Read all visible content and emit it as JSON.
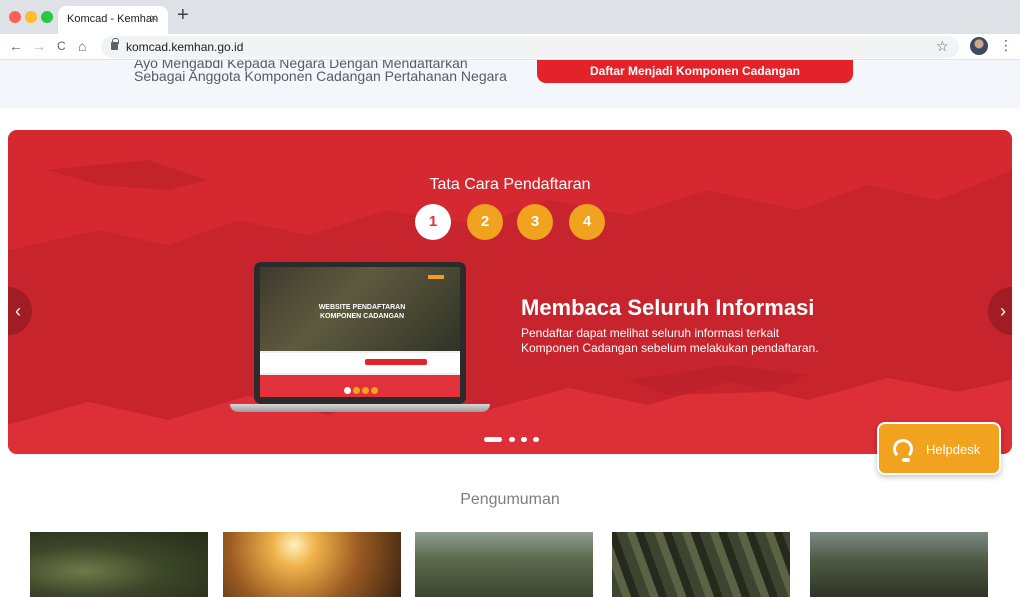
{
  "browser": {
    "tab_title": "Komcad - Kemhan",
    "tab_close": "×",
    "new_tab": "+",
    "url": "komcad.kemhan.go.id",
    "nav": {
      "back": "←",
      "forward": "→",
      "reload": "C",
      "home": "⌂"
    },
    "star": "☆",
    "menu": "⋮"
  },
  "cta": {
    "text_line1": "Ayo Mengabdi Kepada Negara Dengan Mendaftarkan",
    "text_line2": "Sebagai Anggota Komponen Cadangan Pertahanan Negara",
    "button": "Daftar Menjadi Komponen Cadangan"
  },
  "carousel": {
    "title": "Tata Cara Pendaftaran",
    "steps": [
      "1",
      "2",
      "3",
      "4"
    ],
    "active_step": 1,
    "slide_heading": "Membaca Seluruh Informasi",
    "slide_desc": "Pendaftar dapat melihat seluruh informasi terkait Komponen Cadangan sebelum melakukan pendaftaran.",
    "laptop_screen_text": "WEBSITE PENDAFTARAN KOMPONEN CADANGAN",
    "prev": "‹",
    "next": "›",
    "indicator_count": 4,
    "active_indicator": 1
  },
  "helpdesk": {
    "label": "Helpdesk",
    "icon": "headset-icon"
  },
  "announcements": {
    "title": "Pengumuman",
    "thumbnails": [
      "camouflage-photo",
      "soldier-sunset-photo",
      "soldiers-group-photo",
      "marching-soldiers-photo",
      "saluting-soldiers-photo"
    ]
  },
  "colors": {
    "brand_red": "#e2313a",
    "button_red": "#e32229",
    "accent_orange": "#f1a21f"
  }
}
